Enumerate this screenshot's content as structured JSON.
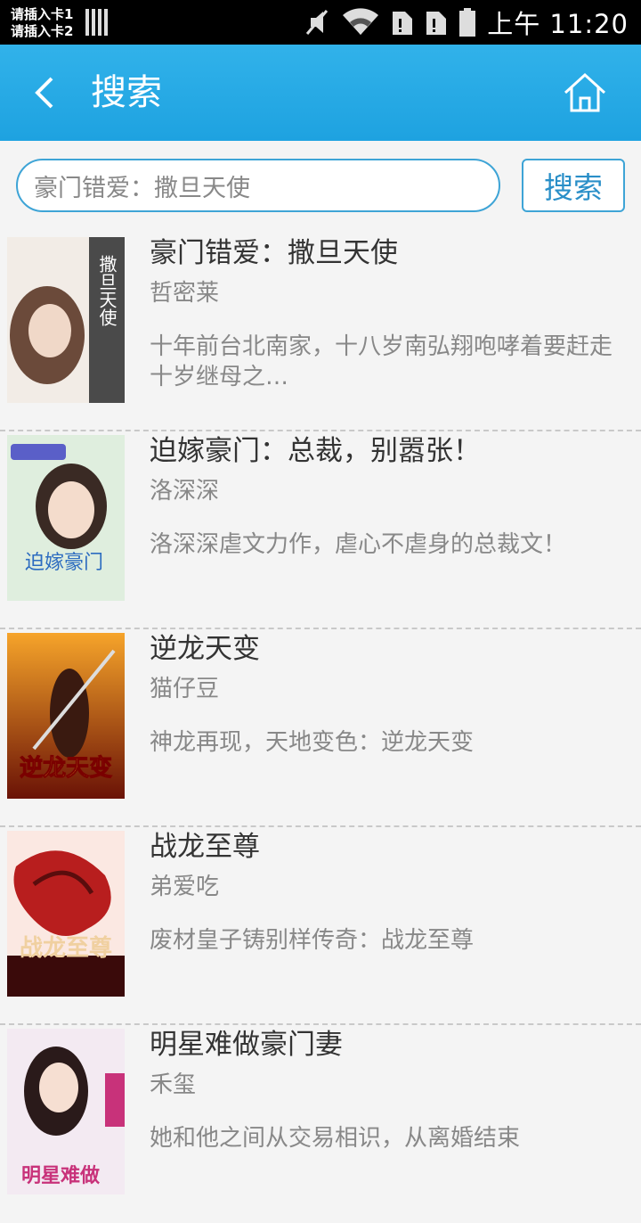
{
  "status_bar": {
    "sim1": "请插入卡1",
    "sim2": "请插入卡2",
    "time": "上午 11:20"
  },
  "app_bar": {
    "title": "搜索",
    "back_icon": "chevron-left-icon",
    "home_icon": "home-icon"
  },
  "search": {
    "value": "豪门错爱：撒旦天使",
    "button_label": "搜索"
  },
  "results": [
    {
      "title": "豪门错爱：撒旦天使",
      "author": "哲密莱",
      "description": "十年前台北南家，十八岁南弘翔咆哮着要赶走十岁继母之…",
      "cover_text": "撒旦天使",
      "cover_colors": [
        "#f2ece6",
        "#3a3a3a"
      ]
    },
    {
      "title": "迫嫁豪门：总裁，别嚣张！",
      "author": "洛深深",
      "description": "洛深深虐文力作，虐心不虐身的总裁文！",
      "cover_text": "迫嫁豪门",
      "cover_colors": [
        "#dfeede",
        "#2d6cc0"
      ]
    },
    {
      "title": "逆龙天变",
      "author": "猫仔豆",
      "description": "神龙再现，天地变色：逆龙天变",
      "cover_text": "逆龙天变",
      "cover_colors": [
        "#7a1e0c",
        "#f4a21a"
      ]
    },
    {
      "title": "战龙至尊",
      "author": "弟爱吃",
      "description": "废材皇子铸别样传奇：战龙至尊",
      "cover_text": "战龙至尊",
      "cover_colors": [
        "#5a0d0d",
        "#d23a2a"
      ]
    },
    {
      "title": "明星难做豪门妻",
      "author": "禾玺",
      "description": "她和他之间从交易相识，从离婚结束",
      "cover_text": "明星难做",
      "cover_colors": [
        "#f3eaf2",
        "#c8327a"
      ]
    }
  ]
}
